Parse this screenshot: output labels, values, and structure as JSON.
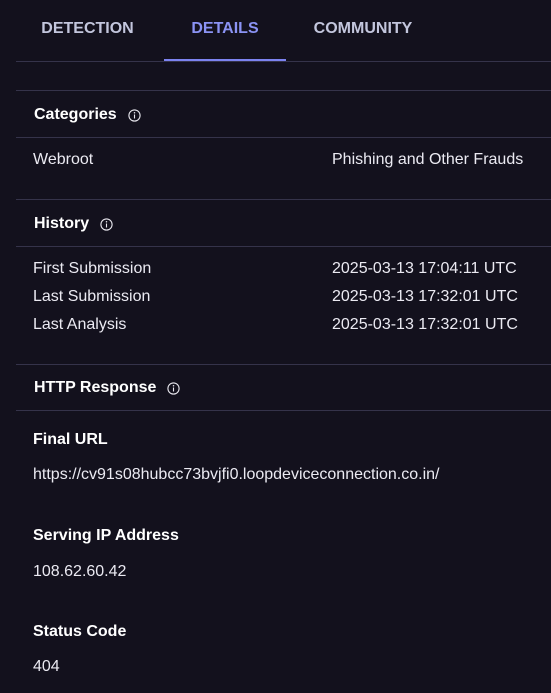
{
  "tabs": [
    {
      "label": "DETECTION"
    },
    {
      "label": "DETAILS"
    },
    {
      "label": "COMMUNITY"
    }
  ],
  "active_tab": "DETAILS",
  "categories": {
    "title": "Categories",
    "rows": [
      {
        "label": "Webroot",
        "value": "Phishing and Other Frauds"
      }
    ]
  },
  "history": {
    "title": "History",
    "rows": [
      {
        "label": "First Submission",
        "value": "2025-03-13 17:04:11 UTC"
      },
      {
        "label": "Last Submission",
        "value": "2025-03-13 17:32:01 UTC"
      },
      {
        "label": "Last Analysis",
        "value": "2025-03-13 17:32:01 UTC"
      }
    ]
  },
  "http_response": {
    "title": "HTTP Response",
    "final_url_label": "Final URL",
    "final_url": "https://cv91s08hubcc73bvjfi0.loopdeviceconnection.co.in/",
    "serving_ip_label": "Serving IP Address",
    "serving_ip": "108.62.60.42",
    "status_code_label": "Status Code",
    "status_code": "404"
  },
  "colors": {
    "background": "#13111d",
    "accent": "#7c83f0",
    "divider": "#35334a"
  },
  "icons": {
    "info": "info-circle-icon"
  }
}
